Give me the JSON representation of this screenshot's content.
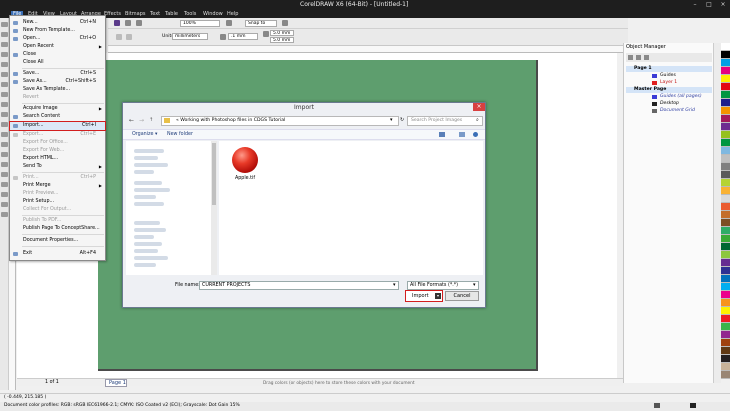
{
  "app": {
    "title": "CorelDRAW X6 (64-Bit) - [Untitled-1]",
    "window_controls": [
      "minimize-icon",
      "maximize-icon",
      "close-icon"
    ]
  },
  "menubar": {
    "items": [
      "File",
      "Edit",
      "View",
      "Layout",
      "Arrange",
      "Effects",
      "Bitmaps",
      "Text",
      "Table",
      "Tools",
      "Window",
      "Help"
    ],
    "active": "File"
  },
  "toolbar": {
    "zoom": "100%",
    "snap": "Snap to",
    "units_label": "Units:",
    "units": "millimeters",
    "nudge": ".1 mm",
    "dup_x": "5.0 mm",
    "dup_y": "5.0 mm"
  },
  "file_menu": {
    "items": [
      {
        "label": "New...",
        "shortcut": "Ctrl+N",
        "enabled": true
      },
      {
        "label": "New From Template...",
        "shortcut": "",
        "enabled": true
      },
      {
        "label": "Open...",
        "shortcut": "Ctrl+O",
        "enabled": true
      },
      {
        "label": "Open Recent",
        "shortcut": "",
        "enabled": true,
        "submenu": true
      },
      {
        "label": "Close",
        "shortcut": "",
        "enabled": true
      },
      {
        "label": "Close All",
        "shortcut": "",
        "enabled": true
      },
      {
        "label": "Save...",
        "shortcut": "Ctrl+S",
        "enabled": true
      },
      {
        "label": "Save As...",
        "shortcut": "Ctrl+Shift+S",
        "enabled": true
      },
      {
        "label": "Save As Template...",
        "shortcut": "",
        "enabled": true
      },
      {
        "label": "Revert",
        "shortcut": "",
        "enabled": false
      },
      {
        "label": "Acquire Image",
        "shortcut": "",
        "enabled": true,
        "submenu": true
      },
      {
        "label": "Search Content",
        "shortcut": "",
        "enabled": true
      },
      {
        "label": "Import...",
        "shortcut": "Ctrl+I",
        "enabled": true,
        "highlighted": true
      },
      {
        "label": "Export...",
        "shortcut": "Ctrl+E",
        "enabled": false
      },
      {
        "label": "Export For Office...",
        "shortcut": "",
        "enabled": false
      },
      {
        "label": "Export For Web...",
        "shortcut": "",
        "enabled": false
      },
      {
        "label": "Export HTML...",
        "shortcut": "",
        "enabled": true
      },
      {
        "label": "Send To",
        "shortcut": "",
        "enabled": true,
        "submenu": true
      },
      {
        "label": "Print...",
        "shortcut": "Ctrl+P",
        "enabled": false
      },
      {
        "label": "Print Merge",
        "shortcut": "",
        "enabled": true,
        "submenu": true
      },
      {
        "label": "Print Preview...",
        "shortcut": "",
        "enabled": false
      },
      {
        "label": "Print Setup...",
        "shortcut": "",
        "enabled": true
      },
      {
        "label": "Collect For Output...",
        "shortcut": "",
        "enabled": false
      },
      {
        "label": "Publish To PDF...",
        "shortcut": "",
        "enabled": false
      },
      {
        "label": "Publish Page To ConceptShare...",
        "shortcut": "",
        "enabled": true
      },
      {
        "label": "Document Properties...",
        "shortcut": "",
        "enabled": true
      },
      {
        "label": "Exit",
        "shortcut": "Alt+F4",
        "enabled": true
      }
    ]
  },
  "import_dialog": {
    "title": "Import",
    "address": "«  Working with Photoshop files in CDGS Tutorial",
    "search_placeholder": "Search Project Images",
    "organize": "Organize ▾",
    "new_folder": "New folder",
    "files": [
      {
        "name": "Apple.tif"
      }
    ],
    "file_name_label": "File name:",
    "file_name": "CURRENT PROJECTS",
    "file_type": "All File Formats (*.*)",
    "import_button": "Import",
    "cancel_button": "Cancel"
  },
  "object_manager": {
    "title": "Object Manager",
    "layers": [
      {
        "label": "Page 1",
        "type": "page"
      },
      {
        "label": "Guides",
        "type": "layer",
        "color": "#3b3bd6"
      },
      {
        "label": "Layer 1",
        "type": "layer",
        "color": "#e02020"
      },
      {
        "label": "Master Page",
        "type": "page"
      },
      {
        "label": "Guides (all pages)",
        "type": "layer",
        "color": "#3b3bd6"
      },
      {
        "label": "Desktop",
        "type": "layer",
        "color": "#222222"
      },
      {
        "label": "Document Grid",
        "type": "layer",
        "color": "#666666"
      }
    ]
  },
  "page_nav": {
    "counter": "1   of 1",
    "tab": "Page 1"
  },
  "hint": "Drag colors (or objects) here to store these colors with your document",
  "status": {
    "coords": "( -0.449, 215.185 )",
    "profile": "Document color profiles: RGB: sRGB IEC61966-2.1; CMYK: ISO Coated v2 (ECI); Grayscale: Dot Gain 15%"
  },
  "palette": [
    "#ffffff",
    "#000000",
    "#00a0e6",
    "#e6007e",
    "#ffed00",
    "#e30613",
    "#009640",
    "#1d1d8c",
    "#f39200",
    "#a3195b",
    "#6f2c91",
    "#95c11f",
    "#00963f",
    "#7fb8e0",
    "#c0c0c0",
    "#808080",
    "#5a5a5a",
    "#b5d334",
    "#f9b233",
    "#d9dada",
    "#ea5b2e",
    "#c46d2a",
    "#7d4e24",
    "#2fac66",
    "#3aaa35",
    "#006633",
    "#8dc63f",
    "#662d91",
    "#2e3192",
    "#0072bc",
    "#00aeef",
    "#ec008c",
    "#f7941d",
    "#fff200",
    "#ed1c24",
    "#39b54a",
    "#92278f",
    "#a0410d",
    "#603913",
    "#231f20",
    "#c7b299",
    "#998675"
  ]
}
